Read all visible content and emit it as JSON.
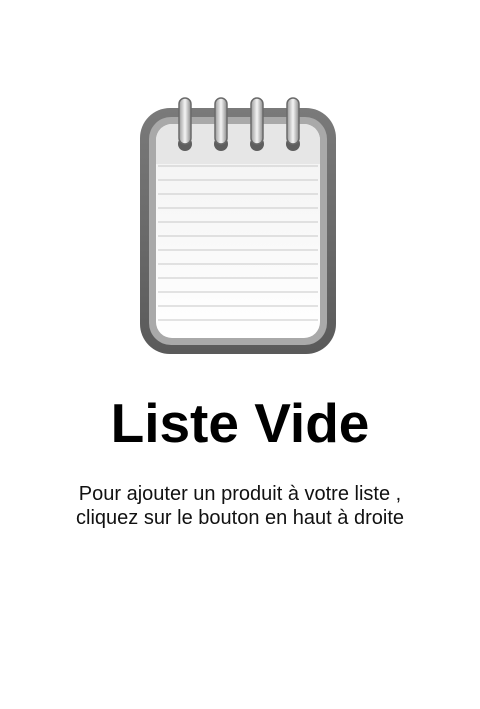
{
  "empty_state": {
    "icon": "notepad-icon",
    "title": "Liste Vide",
    "message_line_1": "Pour ajouter un produit à votre liste ,",
    "message_line_2": "cliquez sur le bouton en haut à droite"
  },
  "colors": {
    "background": "#ffffff",
    "text": "#000000",
    "icon_frame": "#6e6e6e",
    "icon_paper": "#fafafa"
  }
}
